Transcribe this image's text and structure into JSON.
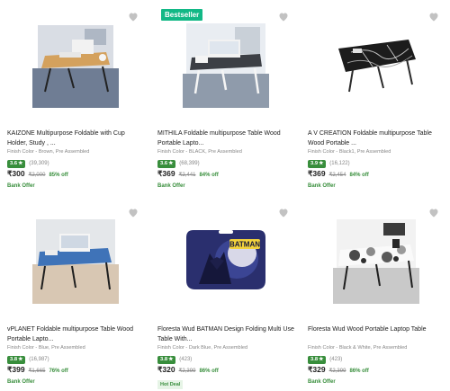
{
  "products": [
    {
      "title": "KAIZONE Multipurpose Foldable with Cup Holder, Study , ...",
      "finish": "Finish Color - Brown, Pre Assembled",
      "rating": "3.6",
      "reviews": "(39,309)",
      "price": "₹300",
      "mrp": "₹2,000",
      "discount": "85% off",
      "offer": "Bank Offer",
      "badge": "",
      "hot_deal": "",
      "wishlist_icon": "heart-icon",
      "image": "wood-laptop-table"
    },
    {
      "title": "MITHILA Foldable multipurpose Table Wood Portable Lapto...",
      "finish": "Finish Color - BLACK, Pre Assembled",
      "rating": "3.6",
      "reviews": "(68,399)",
      "price": "₹369",
      "mrp": "₹2,441",
      "discount": "84% off",
      "offer": "Bank Offer",
      "badge": "Bestseller",
      "hot_deal": "",
      "wishlist_icon": "heart-icon",
      "image": "black-laptop-table"
    },
    {
      "title": "A V CREATION Foldable multipurpose Table Wood Portable ...",
      "finish": "Finish Color - Black1, Pre Assembled",
      "rating": "3.9",
      "reviews": "(16,122)",
      "price": "₹369",
      "mrp": "₹2,454",
      "discount": "84% off",
      "offer": "Bank Offer",
      "badge": "",
      "hot_deal": "",
      "wishlist_icon": "heart-icon",
      "image": "black-marble-table"
    },
    {
      "title": "vPLANET Foldable multipurpose Table Wood Portable Lapto...",
      "finish": "Finish Color - Blue, Pre Assembled",
      "rating": "3.8",
      "reviews": "(16,987)",
      "price": "₹399",
      "mrp": "₹1,665",
      "discount": "76% off",
      "offer": "Bank Offer",
      "badge": "",
      "hot_deal": "",
      "wishlist_icon": "heart-icon",
      "image": "blue-laptop-table"
    },
    {
      "title": "Floresta Wud BATMAN Design Folding Multi Use Table With...",
      "finish": "Finish Color - Dark Blue, Pre Assembled",
      "rating": "3.8",
      "reviews": "(423)",
      "price": "₹320",
      "mrp": "₹2,399",
      "discount": "86% off",
      "offer": "",
      "badge": "",
      "hot_deal": "Hot Deal",
      "wishlist_icon": "heart-icon",
      "image": "batman-table",
      "image_text": "BATMAN"
    },
    {
      "title": "Floresta Wud Wood Portable Laptop Table",
      "finish": "Finish Color - Black & White, Pre Assembled",
      "rating": "3.8",
      "reviews": "(423)",
      "price": "₹329",
      "mrp": "₹2,399",
      "discount": "86% off",
      "offer": "Bank Offer",
      "badge": "",
      "hot_deal": "",
      "wishlist_icon": "heart-icon",
      "image": "floral-table"
    }
  ],
  "colors": {
    "rating_green": "#388e3c",
    "badge_teal": "#12b886",
    "muted_text": "#878787"
  }
}
